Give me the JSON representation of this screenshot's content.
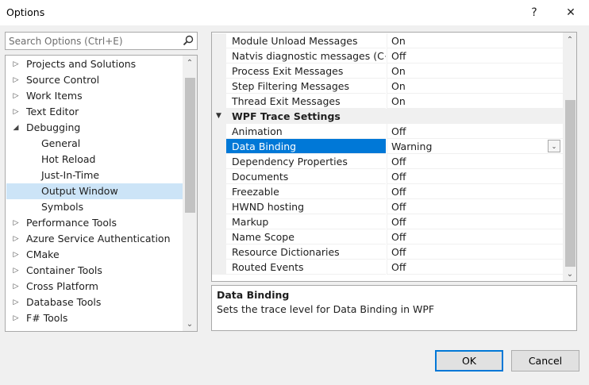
{
  "window": {
    "title": "Options",
    "help_glyph": "?",
    "close_glyph": "✕"
  },
  "search": {
    "placeholder": "Search Options (Ctrl+E)",
    "value": ""
  },
  "tree": {
    "items": [
      {
        "label": "Projects and Solutions",
        "expanded": false,
        "level": 0
      },
      {
        "label": "Source Control",
        "expanded": false,
        "level": 0
      },
      {
        "label": "Work Items",
        "expanded": false,
        "level": 0
      },
      {
        "label": "Text Editor",
        "expanded": false,
        "level": 0
      },
      {
        "label": "Debugging",
        "expanded": true,
        "level": 0
      },
      {
        "label": "General",
        "level": 1
      },
      {
        "label": "Hot Reload",
        "level": 1
      },
      {
        "label": "Just-In-Time",
        "level": 1
      },
      {
        "label": "Output Window",
        "level": 1,
        "selected": true
      },
      {
        "label": "Symbols",
        "level": 1
      },
      {
        "label": "Performance Tools",
        "expanded": false,
        "level": 0
      },
      {
        "label": "Azure Service Authentication",
        "expanded": false,
        "level": 0
      },
      {
        "label": "CMake",
        "expanded": false,
        "level": 0
      },
      {
        "label": "Container Tools",
        "expanded": false,
        "level": 0
      },
      {
        "label": "Cross Platform",
        "expanded": false,
        "level": 0
      },
      {
        "label": "Database Tools",
        "expanded": false,
        "level": 0
      },
      {
        "label": "F# Tools",
        "expanded": false,
        "level": 0
      }
    ]
  },
  "grid": {
    "rows": [
      {
        "type": "prop",
        "name": "Module Unload Messages",
        "value": "On"
      },
      {
        "type": "prop",
        "name": "Natvis diagnostic messages (C++",
        "value": "Off"
      },
      {
        "type": "prop",
        "name": "Process Exit Messages",
        "value": "On"
      },
      {
        "type": "prop",
        "name": "Step Filtering Messages",
        "value": "On"
      },
      {
        "type": "prop",
        "name": "Thread Exit Messages",
        "value": "On"
      },
      {
        "type": "category",
        "name": "WPF Trace Settings"
      },
      {
        "type": "prop",
        "name": "Animation",
        "value": "Off"
      },
      {
        "type": "prop",
        "name": "Data Binding",
        "value": "Warning",
        "selected": true
      },
      {
        "type": "prop",
        "name": "Dependency Properties",
        "value": "Off"
      },
      {
        "type": "prop",
        "name": "Documents",
        "value": "Off"
      },
      {
        "type": "prop",
        "name": "Freezable",
        "value": "Off"
      },
      {
        "type": "prop",
        "name": "HWND hosting",
        "value": "Off"
      },
      {
        "type": "prop",
        "name": "Markup",
        "value": "Off"
      },
      {
        "type": "prop",
        "name": "Name Scope",
        "value": "Off"
      },
      {
        "type": "prop",
        "name": "Resource Dictionaries",
        "value": "Off"
      },
      {
        "type": "prop",
        "name": "Routed Events",
        "value": "Off"
      }
    ]
  },
  "description": {
    "title": "Data Binding",
    "text": "Sets the trace level for Data Binding in WPF"
  },
  "buttons": {
    "ok": "OK",
    "cancel": "Cancel"
  },
  "colors": {
    "selection_blue": "#0078d7",
    "tree_selection": "#cce4f7",
    "chrome": "#f0f0f0"
  }
}
